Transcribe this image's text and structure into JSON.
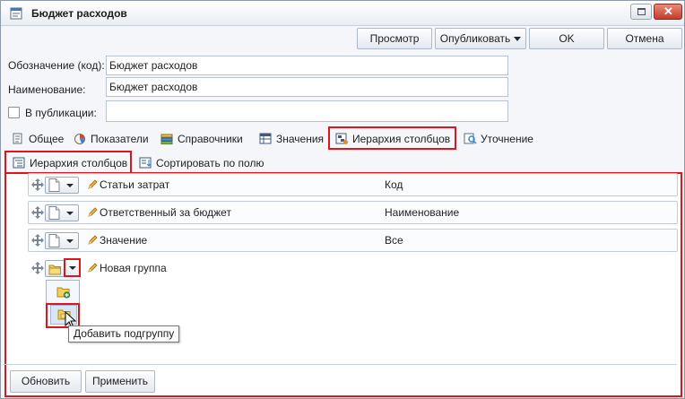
{
  "window": {
    "title": "Бюджет расходов"
  },
  "toolbar": {
    "preview_label": "Просмотр",
    "publish_label": "Опубликовать",
    "ok_label": "OK",
    "cancel_label": "Отмена"
  },
  "form": {
    "code_label": "Обозначение (код):",
    "code_value": "Бюджет расходов",
    "name_label": "Наименование:",
    "name_value": "Бюджет расходов",
    "publish_label": "В публикации:",
    "publish_value": "",
    "publish_checked": false
  },
  "tabs": [
    {
      "label": "Общее",
      "icon": "general-icon"
    },
    {
      "label": "Показатели",
      "icon": "indicators-icon"
    },
    {
      "label": "Справочники",
      "icon": "directories-icon"
    },
    {
      "label": "Значения",
      "icon": "values-icon"
    },
    {
      "label": "Иерархия столбцов",
      "icon": "column-hierarchy-icon",
      "active": true
    },
    {
      "label": "Уточнение",
      "icon": "refine-icon"
    }
  ],
  "subtabs": [
    {
      "label": "Иерархия столбцов",
      "icon": "hierarchy-icon",
      "active": true
    },
    {
      "label": "Сортировать по полю",
      "icon": "sort-icon"
    }
  ],
  "hierarchy_rows": [
    {
      "name": "Статьи затрат",
      "value": "Код",
      "type": "document"
    },
    {
      "name": "Ответственный за бюджет",
      "value": "Наименование",
      "type": "document"
    },
    {
      "name": "Значение",
      "value": "Все",
      "type": "document"
    },
    {
      "name": "Новая группа",
      "value": "",
      "type": "folder"
    }
  ],
  "dropdown": {
    "items": [
      {
        "icon": "add-folder-icon"
      },
      {
        "icon": "add-subgroup-icon",
        "selected": true
      }
    ],
    "tooltip": "Добавить подгруппу"
  },
  "footer": {
    "refresh_label": "Обновить",
    "apply_label": "Применить"
  },
  "colors": {
    "highlight": "#e2141b",
    "accent": "#2f7fd1"
  }
}
